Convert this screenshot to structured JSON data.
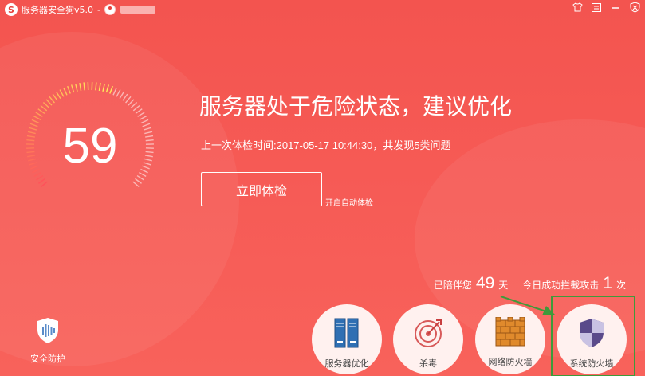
{
  "colors": {
    "background": "#f65a55",
    "annotation": "#3f9a3a",
    "accent": "#e8403b"
  },
  "titlebar": {
    "logo_glyph": "S",
    "app_title": "服务器安全狗v5.0",
    "separator": "-",
    "user_name": "blurred",
    "controls": [
      "shirt-icon",
      "list-icon",
      "minimize-icon",
      "close-shield-icon"
    ]
  },
  "status": {
    "score": "59",
    "headline": "服务器处于危险状态，建议优化",
    "last_check": "上一次体检时间:2017-05-17 10:44:30，共发现5类问题",
    "check_button": "立即体检",
    "auto_check_link": "开启自动体检"
  },
  "stats": {
    "accompany_prefix": "已陪伴您",
    "accompany_days": "49",
    "accompany_unit": "天",
    "blocked_prefix": "今日成功拦截攻击",
    "blocked_count": "1",
    "blocked_unit": "次"
  },
  "protection": {
    "label": "安全防护",
    "icon": "shield-icon"
  },
  "tools": [
    {
      "label": "服务器优化",
      "icon": "server-optimize-icon"
    },
    {
      "label": "杀毒",
      "icon": "antivirus-target-icon"
    },
    {
      "label": "网络防火墙",
      "icon": "brick-wall-icon"
    },
    {
      "label": "系统防火墙",
      "icon": "system-shield-icon"
    }
  ]
}
